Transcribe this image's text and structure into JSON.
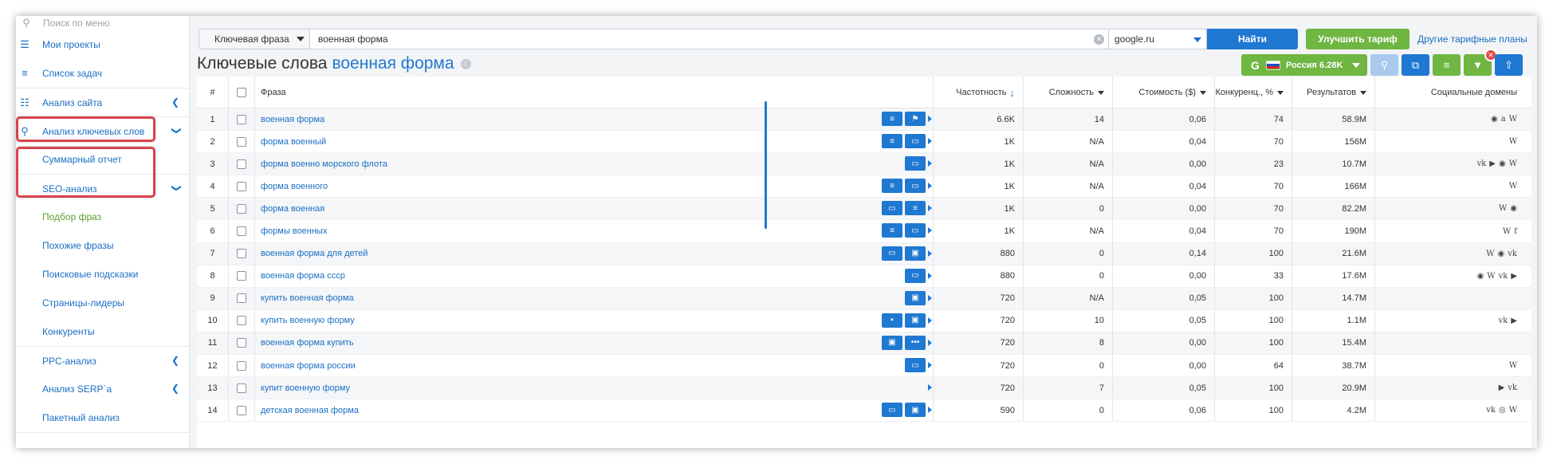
{
  "sidebar": {
    "search_placeholder": "Поиск по меню",
    "items": [
      {
        "label": "Мои проекты",
        "icon": "menu-icon"
      },
      {
        "label": "Список задач",
        "icon": "list-icon"
      },
      {
        "label": "Анализ сайта",
        "icon": "site-analysis-icon"
      },
      {
        "label": "Анализ ключевых слов",
        "icon": "key-icon"
      },
      {
        "label": "Суммарный отчет"
      },
      {
        "label": "SEO-анализ"
      },
      {
        "label": "Подбор фраз"
      },
      {
        "label": "Похожие фразы"
      },
      {
        "label": "Поисковые подсказки"
      },
      {
        "label": "Страницы-лидеры"
      },
      {
        "label": "Конкуренты"
      },
      {
        "label": "PPC-анализ"
      },
      {
        "label": "Анализ SERP`а"
      },
      {
        "label": "Пакетный анализ"
      }
    ]
  },
  "search": {
    "type_label": "Ключевая фраза",
    "query": "военная форма",
    "engine": "google.ru",
    "find_label": "Найти",
    "upgrade_label": "Улучшить тариф",
    "plans_label": "Другие тарифные планы"
  },
  "title": {
    "prefix": "Ключевые слова",
    "keyword": "военная форма"
  },
  "toolbar": {
    "region_label": "Россия 6.28K",
    "g_letter": "G",
    "flag_colors": [
      "#ffffff",
      "#1f4fbf",
      "#d7262e"
    ]
  },
  "table": {
    "headers": {
      "num": "#",
      "phrase": "Фраза",
      "freq": "Частотность",
      "difficulty": "Сложность",
      "cost": "Стоимость ($)",
      "competition": "Конкуренц., %",
      "results": "Результатов",
      "social": "Социальные домены"
    },
    "rows": [
      {
        "n": "1",
        "phrase": "военная форма",
        "acts": [
          "≡",
          "⚑"
        ],
        "freq": "6.6K",
        "diff": "14",
        "cost": "0,06",
        "comp": "74",
        "res": "58.9M",
        "soc": [
          "◉",
          "a",
          "W"
        ]
      },
      {
        "n": "2",
        "phrase": "форма военный",
        "acts": [
          "≡",
          "▭"
        ],
        "freq": "1K",
        "diff": "N/A",
        "cost": "0,04",
        "comp": "70",
        "res": "156M",
        "soc": [
          "W"
        ]
      },
      {
        "n": "3",
        "phrase": "форма военно морского флота",
        "acts": [
          "▭"
        ],
        "freq": "1K",
        "diff": "N/A",
        "cost": "0,00",
        "comp": "23",
        "res": "10.7M",
        "soc": [
          "vk",
          "▶",
          "◉",
          "W"
        ]
      },
      {
        "n": "4",
        "phrase": "форма военного",
        "acts": [
          "≡",
          "▭"
        ],
        "freq": "1K",
        "diff": "N/A",
        "cost": "0,04",
        "comp": "70",
        "res": "166M",
        "soc": [
          "W"
        ]
      },
      {
        "n": "5",
        "phrase": "форма военная",
        "acts": [
          "▭",
          "≡"
        ],
        "freq": "1K",
        "diff": "0",
        "cost": "0,00",
        "comp": "70",
        "res": "82.2M",
        "soc": [
          "W",
          "◉"
        ]
      },
      {
        "n": "6",
        "phrase": "формы военных",
        "acts": [
          "≡",
          "▭"
        ],
        "freq": "1K",
        "diff": "N/A",
        "cost": "0,04",
        "comp": "70",
        "res": "190M",
        "soc": [
          "W",
          "f"
        ]
      },
      {
        "n": "7",
        "phrase": "военная форма для детей",
        "acts": [
          "▭",
          "▣"
        ],
        "freq": "880",
        "diff": "0",
        "cost": "0,14",
        "comp": "100",
        "res": "21.6M",
        "soc": [
          "W",
          "◉",
          "vk"
        ]
      },
      {
        "n": "8",
        "phrase": "военная форма ссср",
        "acts": [
          "▭"
        ],
        "freq": "880",
        "diff": "0",
        "cost": "0,00",
        "comp": "33",
        "res": "17.6M",
        "soc": [
          "◉",
          "W",
          "vk",
          "▶"
        ]
      },
      {
        "n": "9",
        "phrase": "купить военная форма",
        "acts": [
          "▣"
        ],
        "freq": "720",
        "diff": "N/A",
        "cost": "0,05",
        "comp": "100",
        "res": "14.7M",
        "soc": []
      },
      {
        "n": "10",
        "phrase": "купить военную форму",
        "acts": [
          "▪",
          "▣"
        ],
        "freq": "720",
        "diff": "10",
        "cost": "0,05",
        "comp": "100",
        "res": "1.1M",
        "soc": [
          "vk",
          "▶"
        ]
      },
      {
        "n": "11",
        "phrase": "военная форма купить",
        "acts": [
          "▣",
          "•••"
        ],
        "freq": "720",
        "diff": "8",
        "cost": "0,00",
        "comp": "100",
        "res": "15.4M",
        "soc": []
      },
      {
        "n": "12",
        "phrase": "военная форма россии",
        "acts": [
          "▭"
        ],
        "freq": "720",
        "diff": "0",
        "cost": "0,00",
        "comp": "64",
        "res": "38.7M",
        "soc": [
          "W"
        ]
      },
      {
        "n": "13",
        "phrase": "купит военную форму",
        "acts": [],
        "freq": "720",
        "diff": "7",
        "cost": "0,05",
        "comp": "100",
        "res": "20.9M",
        "soc": [
          "▶",
          "vk"
        ]
      },
      {
        "n": "14",
        "phrase": "детская военная форма",
        "acts": [
          "▭",
          "▣"
        ],
        "freq": "590",
        "diff": "0",
        "cost": "0,06",
        "comp": "100",
        "res": "4.2M",
        "soc": [
          "vk",
          "◎",
          "W"
        ]
      }
    ]
  },
  "colors": {
    "accent": "#1f78d1",
    "green": "#6fb642",
    "highlight": "#d9434f",
    "link": "#1a6fc4"
  }
}
